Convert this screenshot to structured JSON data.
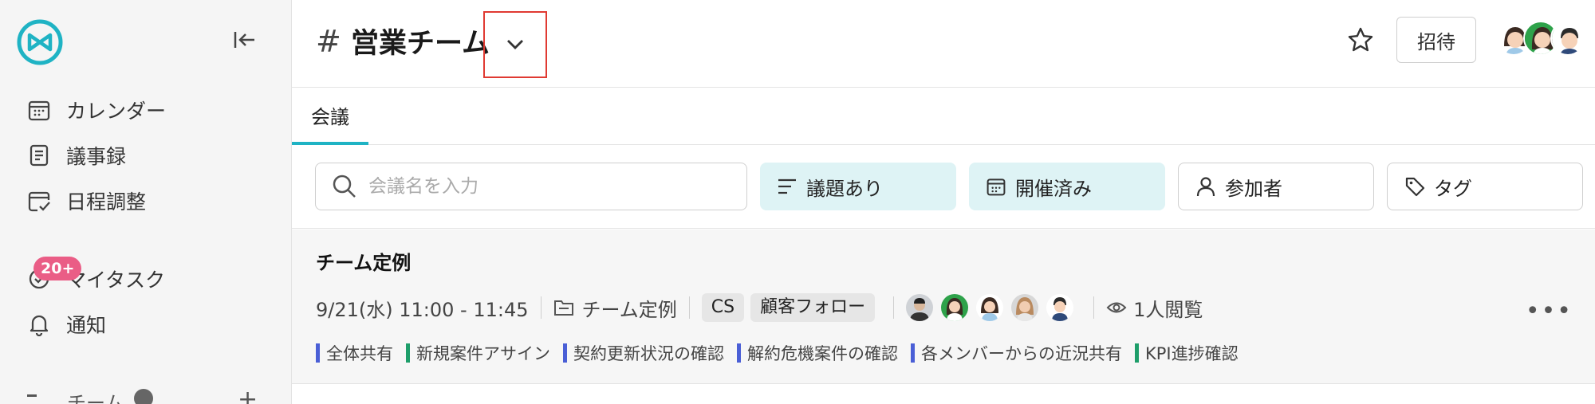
{
  "sidebar": {
    "nav": [
      {
        "label": "カレンダー",
        "icon": "calendar-icon"
      },
      {
        "label": "議事録",
        "icon": "document-icon"
      },
      {
        "label": "日程調整",
        "icon": "schedule-icon"
      }
    ],
    "tasks": {
      "label": "マイタスク",
      "badge": "20+",
      "icon": "task-icon"
    },
    "notifications": {
      "label": "通知",
      "icon": "bell-icon"
    },
    "team_label": "チーム"
  },
  "header": {
    "title": "営業チーム",
    "invite_label": "招待"
  },
  "tabs": [
    {
      "label": "会議"
    }
  ],
  "filters": {
    "search_placeholder": "会議名を入力",
    "chips": [
      {
        "label": "議題あり",
        "icon": "list-icon"
      },
      {
        "label": "開催済み",
        "icon": "calendar-icon"
      },
      {
        "label": "参加者",
        "icon": "person-icon"
      },
      {
        "label": "タグ",
        "icon": "tag-icon"
      }
    ]
  },
  "meeting": {
    "title": "チーム定例",
    "datetime": "9/21(水) 11:00 - 11:45",
    "folder": "チーム定例",
    "tags": [
      "CS",
      "顧客フォロー"
    ],
    "views": "1人閲覧",
    "agenda": [
      {
        "label": "全体共有",
        "color": "#4a5fd6"
      },
      {
        "label": "新規案件アサイン",
        "color": "#1e9e6a"
      },
      {
        "label": "契約更新状況の確認",
        "color": "#4a5fd6"
      },
      {
        "label": "解約危機案件の確認",
        "color": "#4a5fd6"
      },
      {
        "label": "各メンバーからの近況共有",
        "color": "#4a5fd6"
      },
      {
        "label": "KPI進捗確認",
        "color": "#1e9e6a"
      }
    ]
  },
  "colors": {
    "accent": "#1fb3c4",
    "badge": "#ea5d86",
    "highlight_border": "#e03a32"
  }
}
